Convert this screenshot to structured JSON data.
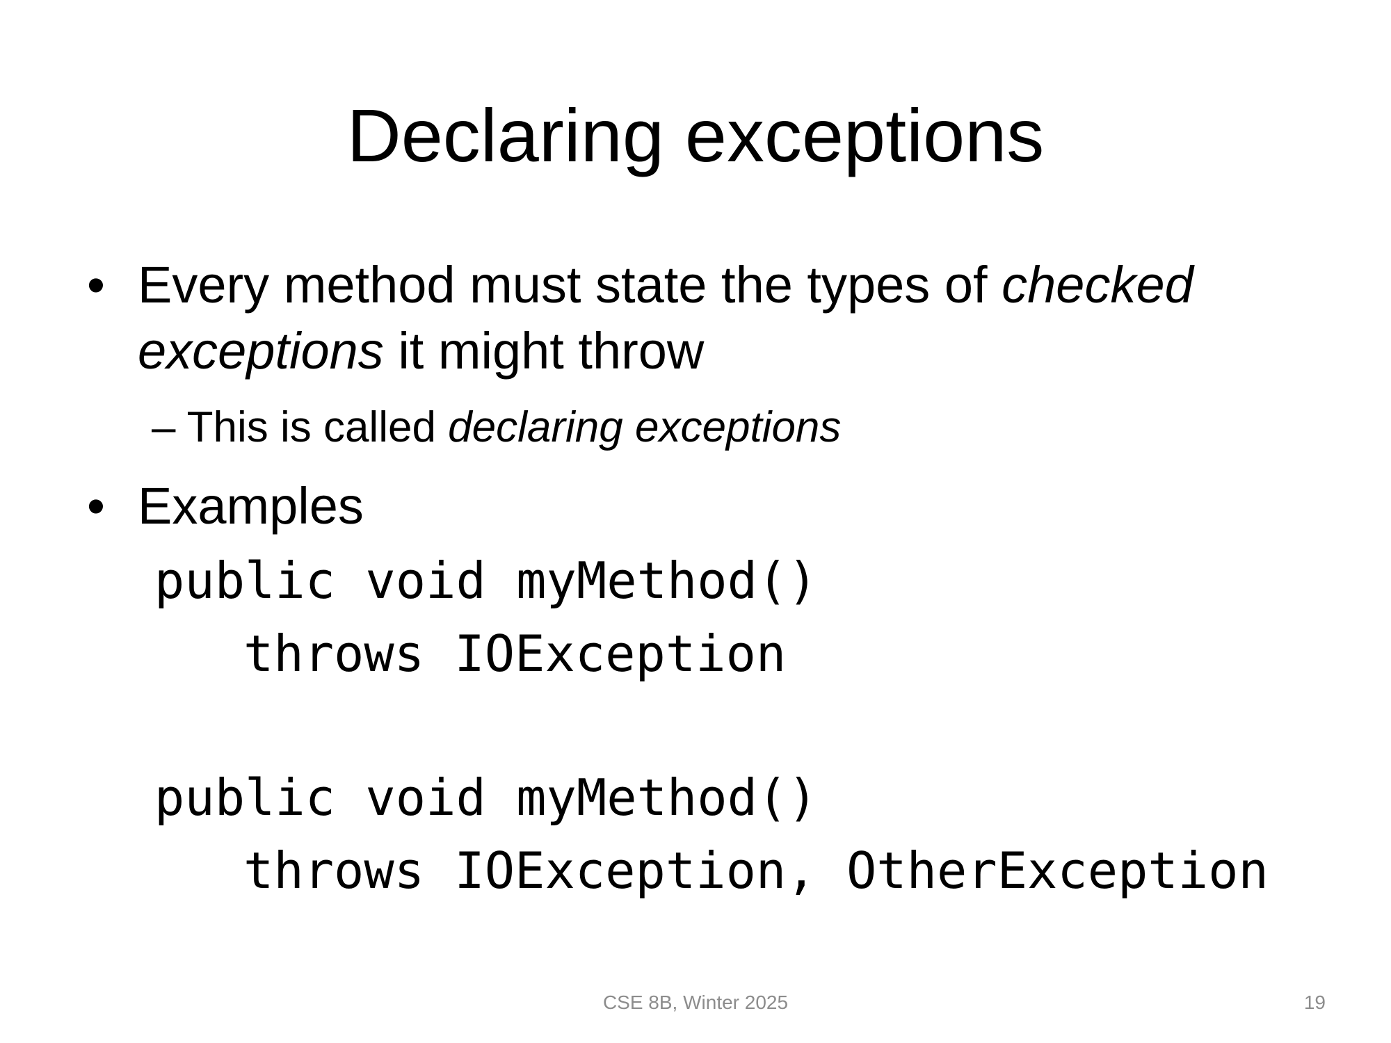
{
  "slide": {
    "title": "Declaring exceptions",
    "bullet_symbol": "•",
    "bullet1": {
      "line1_a": "Every method must state the types of ",
      "line1_b": "checked",
      "line2_a": "exceptions",
      "line2_b": " it might throw"
    },
    "sub1": {
      "dash": "–",
      "text_a": "This is called ",
      "text_b": "declaring exceptions"
    },
    "bullet2": {
      "text": "Examples"
    },
    "code": {
      "example1_line1": "public void myMethod()",
      "example1_line2": "throws IOException",
      "example2_line1": "public void myMethod()",
      "example2_line2": "throws IOException, OtherException"
    },
    "footer": {
      "course": "CSE 8B, Winter 2025",
      "page_number": "19"
    }
  }
}
